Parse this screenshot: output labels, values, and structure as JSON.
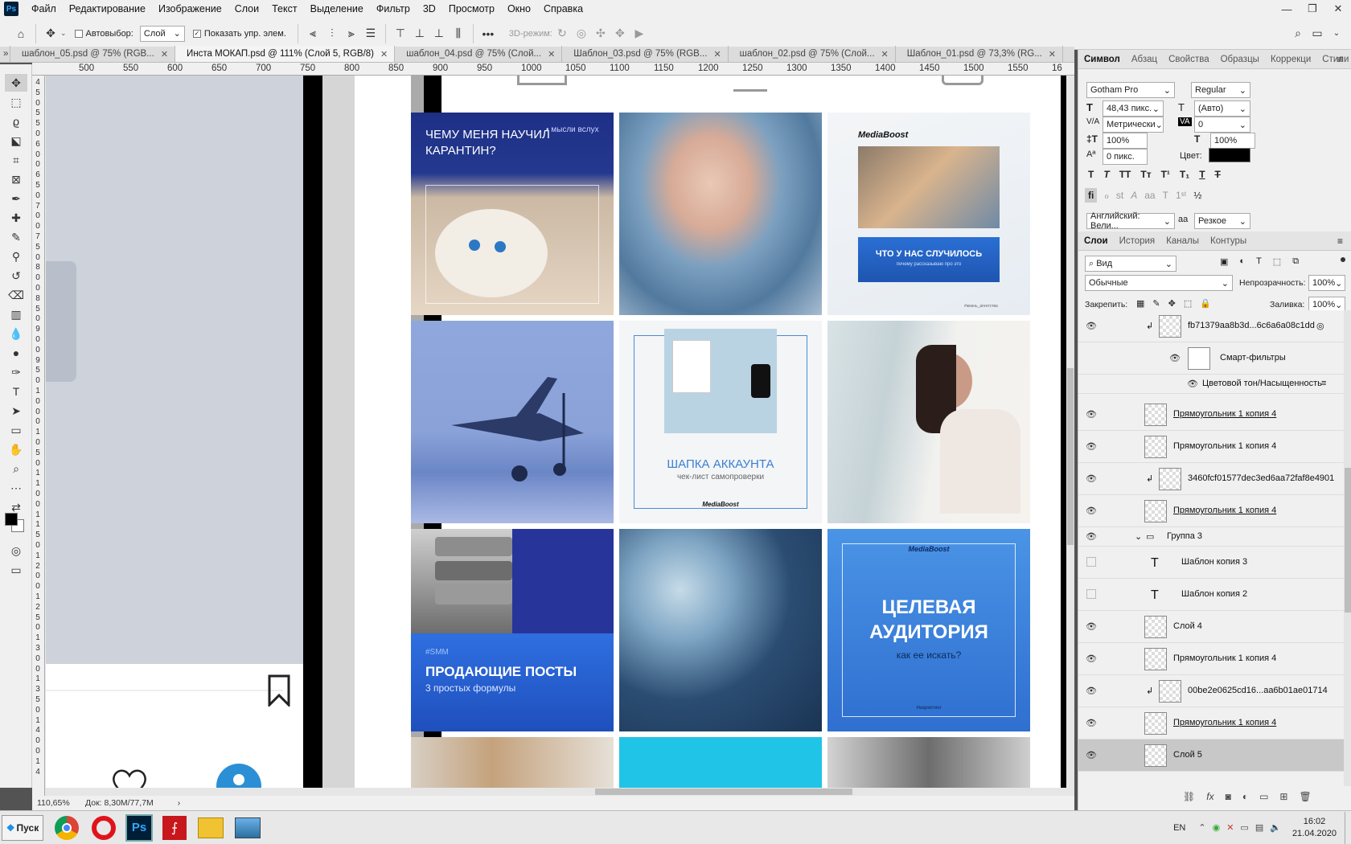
{
  "menubar": {
    "items": [
      "Файл",
      "Редактирование",
      "Изображение",
      "Слои",
      "Текст",
      "Выделение",
      "Фильтр",
      "3D",
      "Просмотр",
      "Окно",
      "Справка"
    ]
  },
  "options": {
    "autoselect_label": "Автовыбор:",
    "layer_select": "Слой",
    "show_controls_label": "Показать упр. элем.",
    "mode3d_label": "3D-режим:"
  },
  "tabs": [
    {
      "label": "шаблон_05.psd @ 75% (RGB..."
    },
    {
      "label": "Инста МОКАП.psd @ 111% (Слой 5, RGB/8)"
    },
    {
      "label": "шаблон_04.psd @ 75% (Слой..."
    },
    {
      "label": "Шаблон_03.psd @ 75% (RGB..."
    },
    {
      "label": "шаблон_02.psd @ 75% (Слой..."
    },
    {
      "label": "Шаблон_01.psd @ 73,3% (RG..."
    }
  ],
  "ruler": {
    "h": [
      "500",
      "550",
      "600",
      "650",
      "700",
      "750",
      "800",
      "850",
      "900",
      "950",
      "1000",
      "1050",
      "1100",
      "1150",
      "1200",
      "1250",
      "1300",
      "1350",
      "1400",
      "1450",
      "1500",
      "1550",
      "16"
    ],
    "v": [
      "4",
      "5",
      "0",
      "5",
      "5",
      "0",
      "6",
      "0",
      "0",
      "6",
      "5",
      "0",
      "7",
      "0",
      "0",
      "7",
      "5",
      "0",
      "8",
      "0",
      "0",
      "8",
      "5",
      "0",
      "9",
      "0",
      "0",
      "9",
      "5",
      "0",
      "1",
      "0",
      "0",
      "0",
      "1",
      "0",
      "5",
      "0",
      "1",
      "1",
      "0",
      "0",
      "1",
      "1",
      "5",
      "0",
      "1",
      "2",
      "0",
      "0",
      "1",
      "2",
      "5",
      "0",
      "1",
      "3",
      "0",
      "0",
      "1",
      "3",
      "5",
      "0",
      "1",
      "4",
      "0",
      "0",
      "1",
      "4"
    ]
  },
  "posts": {
    "p1_title": "ЧЕМУ МЕНЯ НАУЧИЛ КАРАНТИН?",
    "p1_tag": "• мысли вслух",
    "p3_brand": "MediaBoost",
    "p3_title": "ЧТО У НАС СЛУЧИЛОСЬ",
    "p3_sub": "почему рассказываю про это",
    "p3_tag": "#жизнь_агентства",
    "p5_title": "ШАПКА АККАУНТА",
    "p5_sub": "чек-лист самопроверки",
    "p5_brand": "MediaBoost",
    "p7_tag": "#SMM",
    "p7_title": "ПРОДАЮЩИЕ ПОСТЫ",
    "p7_sub": "3 простых формулы",
    "p9_brand": "MediaBoost",
    "p9_title": "ЦЕЛЕВАЯ АУДИТОРИЯ",
    "p9_sub": "как ее искать?",
    "p9_tag": "#маркетинг"
  },
  "status": {
    "zoom": "110,65%",
    "doc": "Док: 8,30M/77,7M"
  },
  "char_panel": {
    "tabs": [
      "Символ",
      "Абзац",
      "Свойства",
      "Образцы",
      "Коррекци",
      "Стили"
    ],
    "font": "Gotham Pro",
    "style": "Regular",
    "size": "48,43 пикс.",
    "leading": "(Авто)",
    "kerning": "Метрически",
    "tracking": "0",
    "vscale": "100%",
    "hscale": "100%",
    "baseline": "0 пикс.",
    "color_label": "Цвет:",
    "lang": "Английский: Вели...",
    "aa_label": "aa",
    "aa": "Резкое"
  },
  "layers_panel": {
    "tabs": [
      "Слои",
      "История",
      "Каналы",
      "Контуры"
    ],
    "filter": "Вид",
    "blend": "Обычные",
    "opacity_label": "Непрозрачность:",
    "opacity": "100%",
    "lock_label": "Закрепить:",
    "fill_label": "Заливка:",
    "fill": "100%",
    "layers": [
      {
        "name": "fb71379aa8b3d...6c6a6a08c1dd",
        "kind": "smart",
        "indent": true,
        "eye": true
      },
      {
        "name": "Смарт-фильтры",
        "kind": "filter",
        "eye": true
      },
      {
        "name": "Цветовой тон/Насыщенность",
        "kind": "filteritem",
        "eye": true
      },
      {
        "name": "Прямоугольник 1 копия 4",
        "kind": "shape",
        "eye": true,
        "under": true
      },
      {
        "name": "Прямоугольник 1 копия 4",
        "kind": "shape",
        "eye": true
      },
      {
        "name": "3460fcf01577dec3ed6aa72faf8e4901",
        "kind": "smart",
        "indent": true,
        "eye": true
      },
      {
        "name": "Прямоугольник 1 копия 4",
        "kind": "shape",
        "eye": true,
        "under": true
      },
      {
        "name": "Группа 3",
        "kind": "group",
        "eye": true
      },
      {
        "name": "Шаблон копия 3",
        "kind": "text",
        "eye": false
      },
      {
        "name": "Шаблон копия 2",
        "kind": "text",
        "eye": false
      },
      {
        "name": "Слой 4",
        "kind": "shape",
        "eye": true
      },
      {
        "name": "Прямоугольник 1 копия 4",
        "kind": "shape",
        "eye": true
      },
      {
        "name": "00be2e0625cd16...aa6b01ae01714",
        "kind": "smart",
        "indent": true,
        "eye": true
      },
      {
        "name": "Прямоугольник 1 копия 4",
        "kind": "shape",
        "eye": true,
        "under": true
      },
      {
        "name": "Слой 5",
        "kind": "shape",
        "eye": true,
        "selected": true
      }
    ]
  },
  "taskbar": {
    "start": "Пуск",
    "lang": "EN",
    "time": "16:02",
    "date": "21.04.2020"
  }
}
